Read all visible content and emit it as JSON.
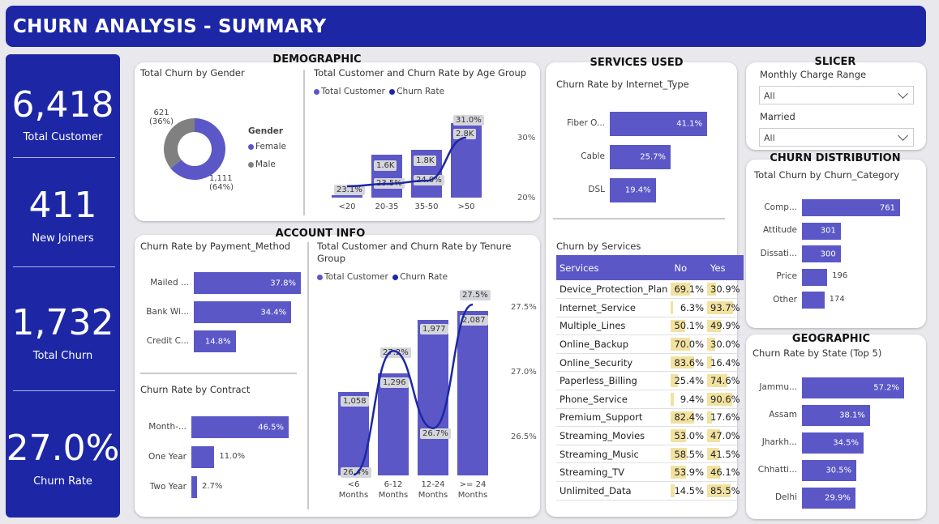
{
  "header": {
    "title": "CHURN ANALYSIS - SUMMARY"
  },
  "kpis": [
    {
      "value": "6,418",
      "label": "Total Customer"
    },
    {
      "value": "411",
      "label": "New Joiners"
    },
    {
      "value": "1,732",
      "label": "Total Churn"
    },
    {
      "value": "27.0%",
      "label": "Churn Rate"
    }
  ],
  "sections": {
    "demographic": "DEMOGRAPHIC",
    "account_info": "ACCOUNT INFO",
    "services_used": "SERVICES USED",
    "slicer": "SLICER",
    "churn_distribution": "CHURN DISTRIBUTION",
    "geographic": "GEOGRAPHIC"
  },
  "slicer": {
    "monthly_label": "Monthly Charge Range",
    "monthly_value": "All",
    "married_label": "Married",
    "married_value": "All"
  },
  "legend": {
    "total_customer": "Total Customer",
    "churn_rate": "Churn Rate"
  },
  "colors": {
    "bar": "#5b57c7",
    "line": "#1d27a5",
    "header": "#1d27a5",
    "male": "#808080",
    "highlight": "#f2e2a0"
  },
  "chart_data": [
    {
      "id": "gender",
      "type": "pie",
      "title": "Total Churn by Gender",
      "legend_title": "Gender",
      "categories": [
        "Female",
        "Male"
      ],
      "values": [
        1111,
        621
      ],
      "labels": [
        [
          "1,111",
          "(64%)"
        ],
        [
          "621",
          "(36%)"
        ]
      ]
    },
    {
      "id": "age_group",
      "type": "bar",
      "title": "Total Customer and Churn Rate by Age Group",
      "categories": [
        "<20",
        "20-35",
        "35-50",
        ">50"
      ],
      "series": [
        {
          "name": "Total Customer",
          "values": [
            0.1,
            1.6,
            1.8,
            2.8
          ],
          "labels": [
            "",
            "1.6K",
            "1.8K",
            "2.8K"
          ]
        },
        {
          "name": "Churn Rate",
          "values": [
            23.1,
            23.5,
            24.0,
            31.0
          ],
          "labels": [
            "23.1%",
            "23.5%",
            "24.0%",
            "31.0%"
          ]
        }
      ],
      "y2_ticks": [
        "30%",
        "20%"
      ]
    },
    {
      "id": "internet_type",
      "type": "bar",
      "title": "Churn Rate by Internet_Type",
      "categories": [
        "Fiber O...",
        "Cable",
        "DSL"
      ],
      "values": [
        41.1,
        25.7,
        19.4
      ],
      "labels": [
        "41.1%",
        "25.7%",
        "19.4%"
      ]
    },
    {
      "id": "payment_method",
      "type": "bar",
      "title": "Churn Rate by Payment_Method",
      "categories": [
        "Mailed ...",
        "Bank Wi...",
        "Credit C..."
      ],
      "values": [
        37.8,
        34.4,
        14.8
      ],
      "labels": [
        "37.8%",
        "34.4%",
        "14.8%"
      ]
    },
    {
      "id": "contract",
      "type": "bar",
      "title": "Churn Rate by Contract",
      "categories": [
        "Month-...",
        "One Year",
        "Two Year"
      ],
      "values": [
        46.5,
        11.0,
        2.7
      ],
      "labels": [
        "46.5%",
        "11.0%",
        "2.7%"
      ]
    },
    {
      "id": "tenure",
      "type": "bar",
      "title": "Total Customer and Churn Rate by Tenure Group",
      "categories": [
        "< 6 Months",
        "6-12 Months",
        "12-24 Months",
        ">= 24 Months"
      ],
      "category_lines": [
        [
          "<6",
          "Months"
        ],
        [
          "6-12",
          "Months"
        ],
        [
          "12-24",
          "Months"
        ],
        [
          ">= 24",
          "Months"
        ]
      ],
      "series": [
        {
          "name": "Total Customer",
          "values": [
            1058,
            1296,
            1977,
            2087
          ],
          "labels": [
            "1,058",
            "1,296",
            "1,977",
            "2,087"
          ]
        },
        {
          "name": "Churn Rate",
          "values": [
            26.4,
            27.2,
            26.7,
            27.5
          ],
          "labels": [
            "26.4%",
            "27.2%",
            "26.7%",
            "27.5%"
          ]
        }
      ],
      "y2_ticks": [
        "27.5%",
        "27.0%",
        "26.5%"
      ]
    },
    {
      "id": "services",
      "type": "table",
      "title": "Churn by Services",
      "columns": [
        "Services",
        "No",
        "Yes"
      ],
      "rows": [
        [
          "Device_Protection_Plan",
          "69.1%",
          "30.9%"
        ],
        [
          "Internet_Service",
          "6.3%",
          "93.7%"
        ],
        [
          "Multiple_Lines",
          "50.1%",
          "49.9%"
        ],
        [
          "Online_Backup",
          "70.0%",
          "30.0%"
        ],
        [
          "Online_Security",
          "83.6%",
          "16.4%"
        ],
        [
          "Paperless_Billing",
          "25.4%",
          "74.6%"
        ],
        [
          "Phone_Service",
          "9.4%",
          "90.6%"
        ],
        [
          "Premium_Support",
          "82.4%",
          "17.6%"
        ],
        [
          "Streaming_Movies",
          "53.0%",
          "47.0%"
        ],
        [
          "Streaming_Music",
          "58.5%",
          "41.5%"
        ],
        [
          "Streaming_TV",
          "53.9%",
          "46.1%"
        ],
        [
          "Unlimited_Data",
          "14.5%",
          "85.5%"
        ]
      ]
    },
    {
      "id": "churn_category",
      "type": "bar",
      "title": "Total Churn by Churn_Category",
      "categories": [
        "Comp...",
        "Attitude",
        "Dissati...",
        "Price",
        "Other"
      ],
      "values": [
        761,
        301,
        300,
        196,
        174
      ],
      "labels": [
        "761",
        "301",
        "300",
        "196",
        "174"
      ]
    },
    {
      "id": "state",
      "type": "bar",
      "title": "Churn Rate by State (Top 5)",
      "categories": [
        "Jammu...",
        "Assam",
        "Jharkh...",
        "Chhatti...",
        "Delhi"
      ],
      "values": [
        57.2,
        38.1,
        34.5,
        30.5,
        29.9
      ],
      "labels": [
        "57.2%",
        "38.1%",
        "34.5%",
        "30.5%",
        "29.9%"
      ]
    }
  ]
}
